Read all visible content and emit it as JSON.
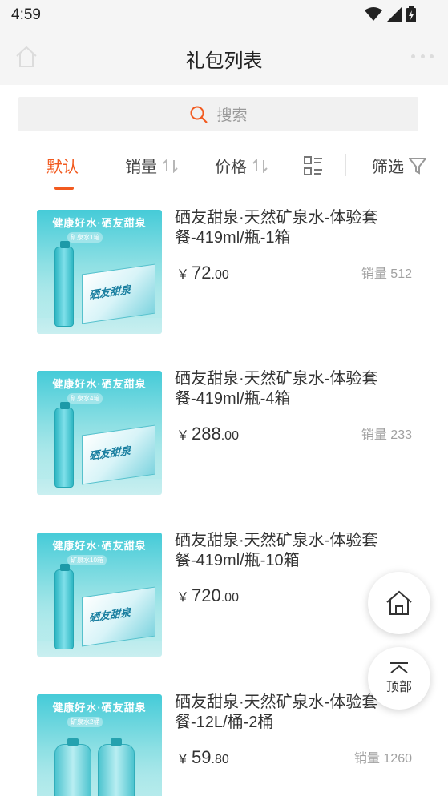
{
  "status": {
    "time": "4:59"
  },
  "header": {
    "title": "礼包列表"
  },
  "search": {
    "placeholder": "搜索"
  },
  "tabs": [
    {
      "label": "默认",
      "active": true
    },
    {
      "label": "销量"
    },
    {
      "label": "价格"
    },
    {
      "label": "筛选"
    }
  ],
  "products": [
    {
      "name": "硒友甜泉·天然矿泉水-体验套餐-419ml/瓶-1箱",
      "price_int": "72",
      "price_dec": ".00",
      "sales": "销量 512",
      "banner": "健康好水·硒友甜泉",
      "sub": "矿泉水1箱",
      "box_logo": "硒友甜泉"
    },
    {
      "name": "硒友甜泉·天然矿泉水-体验套餐-419ml/瓶-4箱",
      "price_int": "288",
      "price_dec": ".00",
      "sales": "销量 233",
      "banner": "健康好水·硒友甜泉",
      "sub": "矿泉水4箱",
      "box_logo": "硒友甜泉"
    },
    {
      "name": "硒友甜泉·天然矿泉水-体验套餐-419ml/瓶-10箱",
      "price_int": "720",
      "price_dec": ".00",
      "sales": "销",
      "banner": "健康好水·硒友甜泉",
      "sub": "矿泉水10箱",
      "box_logo": "硒友甜泉"
    },
    {
      "name": "硒友甜泉·天然矿泉水-体验套餐-12L/桶-2桶",
      "price_int": "59",
      "price_dec": ".80",
      "sales": "销量 1260",
      "banner": "健康好水·硒友甜泉",
      "sub": "矿泉水2桶",
      "box_logo": ""
    }
  ],
  "currency": "￥",
  "fab": {
    "top_label": "顶部"
  },
  "colors": {
    "accent": "#f25a1f",
    "header_bg": "#f5f5f5"
  }
}
